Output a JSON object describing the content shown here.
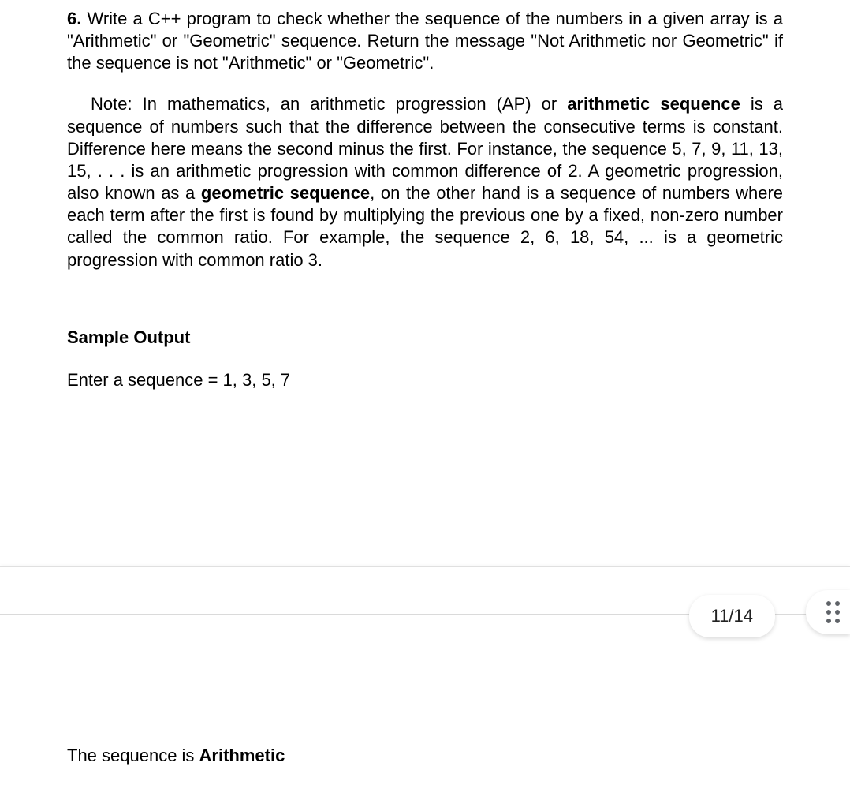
{
  "question": {
    "number": "6.",
    "text_part1": " Write a C++ program to check whether the sequence of the numbers in a given array is a \"Arithmetic\" or \"Geometric\" sequence. Return the message \"Not Arithmetic nor Geometric\" if the sequence is not \"Arithmetic\" or \"Geometric\"."
  },
  "note": {
    "prefix": "Note:  In mathematics, an arithmetic progression (AP) or ",
    "bold1": "arithmetic sequence",
    "mid1": " is a sequence of numbers such that the difference between the consecutive terms is constant. Difference here means the second minus the first. For instance, the sequence 5, 7, 9, 11, 13, 15, . . . is an arithmetic progression with common difference of 2.   A geometric progression, also known as a ",
    "bold2": "geometric sequence",
    "mid2": ", on the other hand  is a sequence of numbers where each term after the first is found by multiplying the previous one by a fixed, non-zero number called the common ratio. For example, the sequence 2, 6, 18, 54, ... is a geometric progression with common ratio 3."
  },
  "sample_output": {
    "heading": "Sample Output",
    "input_line": "Enter a sequence =  1, 3, 5, 7",
    "result_prefix": "The sequence is ",
    "result_value": "Arithmetic"
  },
  "page_indicator": "11/14"
}
